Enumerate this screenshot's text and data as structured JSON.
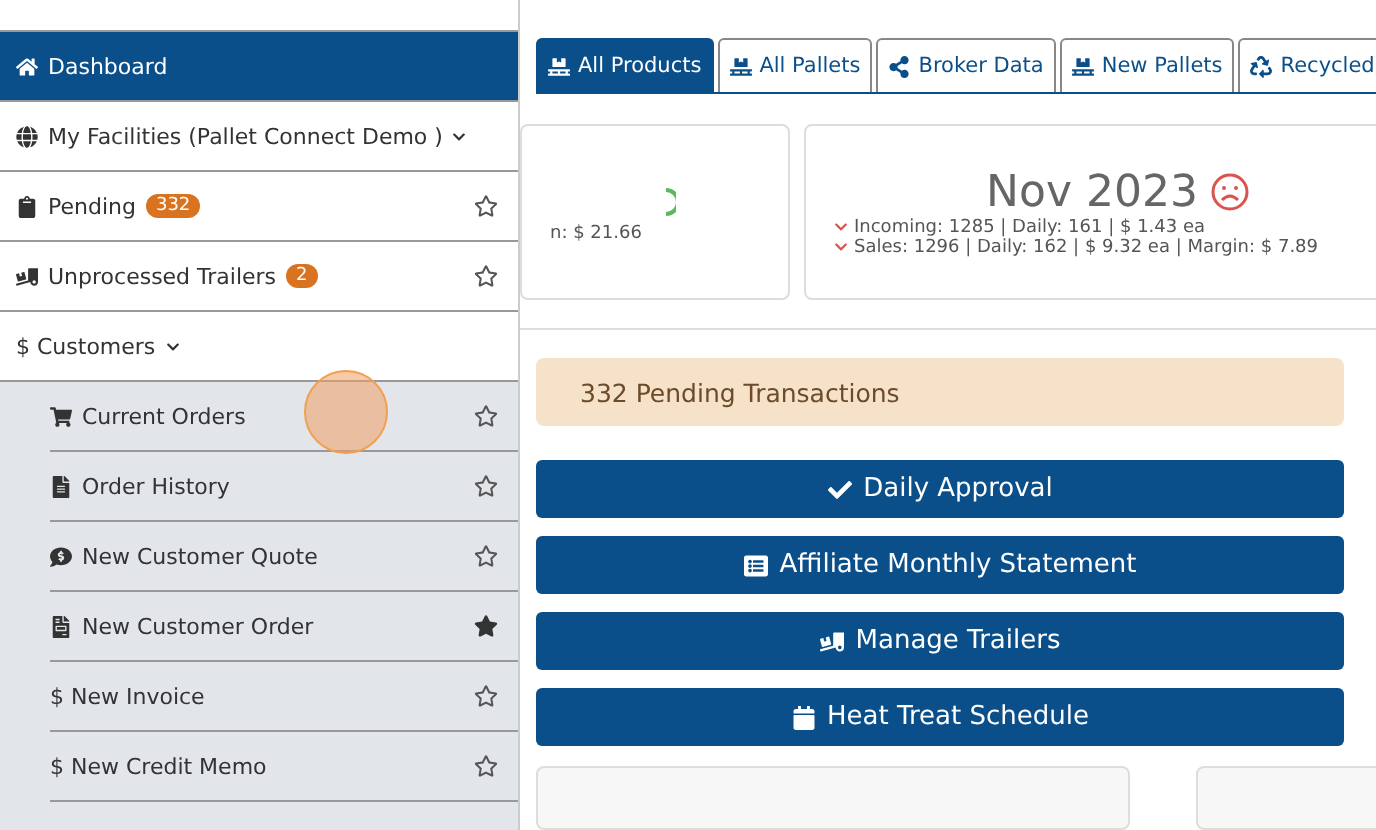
{
  "sidebar": {
    "items": [
      {
        "kind": "link",
        "label": "Dashboard",
        "selected": true
      },
      {
        "kind": "dropdown",
        "label": "My Facilities (Pallet Connect Demo )",
        "selected": false
      },
      {
        "kind": "link",
        "label": "Pending",
        "badge": "332",
        "starred": false,
        "selected": false
      },
      {
        "kind": "link",
        "label": "Unprocessed Trailers",
        "badge": "2",
        "starred": false,
        "selected": false
      },
      {
        "kind": "dropdown",
        "label": "$ Customers",
        "selected": false,
        "children": [
          {
            "label": "Current Orders",
            "starred": false
          },
          {
            "label": "Order History",
            "starred": false
          },
          {
            "label": "New Customer Quote",
            "starred": false
          },
          {
            "label": "New Customer Order",
            "starred": true
          },
          {
            "label": "$ New Invoice",
            "starred": false
          },
          {
            "label": "$ New Credit Memo",
            "starred": false
          }
        ]
      }
    ]
  },
  "tabs": [
    {
      "label": "All Products",
      "selected": true
    },
    {
      "label": "All Pallets",
      "selected": false
    },
    {
      "label": "Broker Data",
      "selected": false
    },
    {
      "label": "New Pallets",
      "selected": false
    },
    {
      "label": "Recycled",
      "selected": false
    }
  ],
  "cards": [
    {
      "lines": [
        "n: $ 21.66"
      ]
    },
    {
      "title": "Nov 2023",
      "lines": [
        "Incoming: 1285 | Daily: 161 | $ 1.43 ea",
        "Sales: 1296 | Daily: 162 | $ 9.32 ea | Margin: $ 7.89"
      ]
    }
  ],
  "alert": "332 Pending Transactions",
  "actions": [
    "Daily Approval",
    "Affiliate Monthly Statement",
    "Manage Trailers",
    "Heat Treat Schedule"
  ]
}
